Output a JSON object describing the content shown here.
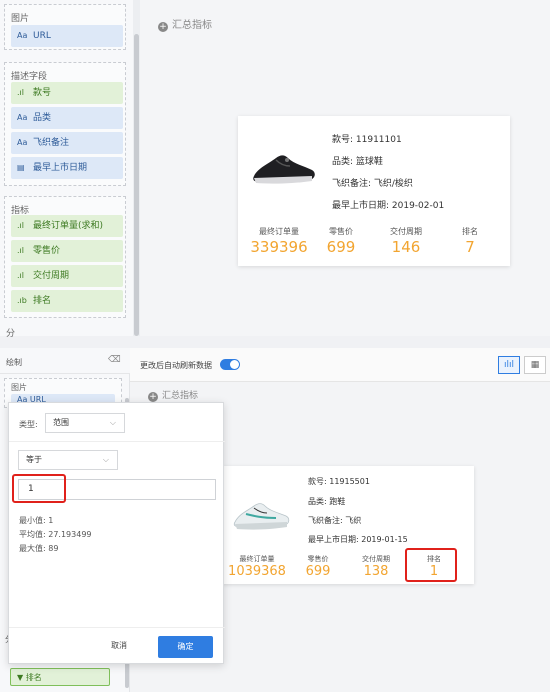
{
  "top": {
    "groups": {
      "image": {
        "title": "图片",
        "items": [
          {
            "icon": "Aa",
            "label": "URL",
            "type": "dim"
          }
        ]
      },
      "description": {
        "title": "描述字段",
        "items": [
          {
            "icon": ".ıl",
            "label": "款号",
            "type": "mea"
          },
          {
            "icon": "Aa",
            "label": "品类",
            "type": "dim"
          },
          {
            "icon": "Aa",
            "label": "飞织备注",
            "type": "dim"
          },
          {
            "icon": "▤",
            "label": "最早上市日期",
            "type": "dim"
          }
        ]
      },
      "metrics": {
        "title": "指标",
        "items": [
          {
            "icon": ".ıl",
            "label": "最终订单量(求和)",
            "type": "mea"
          },
          {
            "icon": ".ıl",
            "label": "零售价",
            "type": "mea"
          },
          {
            "icon": ".ıl",
            "label": "交付周期",
            "type": "mea"
          },
          {
            "icon": ".ıb",
            "label": "排名",
            "type": "mea"
          }
        ]
      },
      "partial_title": "分"
    },
    "summary_title": "汇总指标",
    "card": {
      "info": [
        "款号: 11911101",
        "品类: 篮球鞋",
        "飞织备注: 飞织/梭织",
        "最早上市日期: 2019-02-01"
      ],
      "kpis": [
        {
          "label": "最终订单量",
          "value": "339396"
        },
        {
          "label": "零售价",
          "value": "699"
        },
        {
          "label": "交付周期",
          "value": "146"
        },
        {
          "label": "排名",
          "value": "7"
        }
      ]
    }
  },
  "bottom": {
    "left": {
      "header": "绘制",
      "image_group_title": "图片",
      "image_item": "Aa URL",
      "partial_group": "分",
      "rank_item": "▼ 排名"
    },
    "toolbar": {
      "auto_refresh_label": "更改后自动刷新数据",
      "auto_refresh_on": true
    },
    "summary_title": "汇总指标",
    "card": {
      "info": [
        "款号: 11915501",
        "品类: 跑鞋",
        "飞织备注: 飞织",
        "最早上市日期: 2019-01-15"
      ],
      "kpis": [
        {
          "label": "最终订单量",
          "value": "1039368"
        },
        {
          "label": "零售价",
          "value": "699"
        },
        {
          "label": "交付周期",
          "value": "138"
        },
        {
          "label": "排名",
          "value": "1"
        }
      ]
    },
    "filter_popup": {
      "type_label": "类型:",
      "type_value": "范围",
      "operator_value": "等于",
      "input_value": "1",
      "min": "最小值: 1",
      "avg": "平均值: 27.193499",
      "max": "最大值: 89",
      "cancel": "取消",
      "ok": "确定"
    }
  },
  "colors": {
    "accent": "#2f7de1",
    "kpi": "#f2a531",
    "highlight": "#e0211b"
  },
  "icons": [
    "chart-view-icon",
    "table-view-icon",
    "add-summary-icon",
    "shoe-image",
    "chevron-down-icon"
  ]
}
